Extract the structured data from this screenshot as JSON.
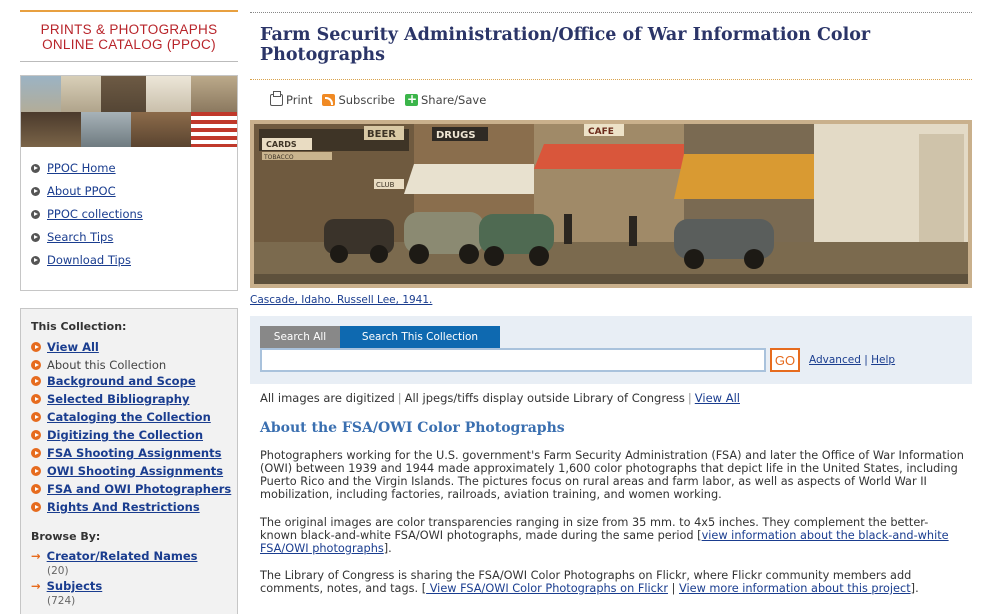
{
  "logo": {
    "line1": "PRINTS & PHOTOGRAPHS",
    "line2": "ONLINE CATALOG (PPOC)"
  },
  "nav": {
    "items": [
      {
        "label": "PPOC Home"
      },
      {
        "label": "About PPOC"
      },
      {
        "label": "PPOC collections"
      },
      {
        "label": "Search Tips"
      },
      {
        "label": "Download Tips"
      }
    ]
  },
  "collection": {
    "heading": "This Collection:",
    "items": [
      {
        "label": "View All",
        "link": true
      },
      {
        "label": "About this Collection",
        "link": false
      },
      {
        "label": "Background and Scope",
        "link": true
      },
      {
        "label": "Selected Bibliography",
        "link": true
      },
      {
        "label": "Cataloging the Collection",
        "link": true
      },
      {
        "label": "Digitizing the Collection",
        "link": true
      },
      {
        "label": "FSA Shooting Assignments",
        "link": true
      },
      {
        "label": "OWI Shooting Assignments",
        "link": true
      },
      {
        "label": "FSA and OWI Photographers",
        "link": true
      },
      {
        "label": "Rights And Restrictions",
        "link": true
      }
    ],
    "browse_heading": "Browse By:",
    "browse": [
      {
        "label": "Creator/Related Names",
        "count": "(20)"
      },
      {
        "label": "Subjects",
        "count": "(724)"
      }
    ]
  },
  "page_title": "Farm Security Administration/Office of War Information Color Photographs",
  "tools": {
    "print": "Print",
    "subscribe": "Subscribe",
    "share": "Share/Save"
  },
  "hero": {
    "caption": "Cascade, Idaho. Russell Lee, 1941.",
    "signs": {
      "beer": "BEER",
      "drugs": "DRUGS",
      "cafe": "CAFE",
      "cards": "CARDS",
      "club": "CLUB",
      "tobacco": "TOBACCO"
    }
  },
  "search": {
    "tab_all": "Search All",
    "tab_this": "Search This Collection",
    "input_value": "",
    "go": "GO",
    "advanced": "Advanced",
    "help": "Help"
  },
  "digitized": {
    "text1": "All images are digitized",
    "text2": "All jpegs/tiffs display outside Library of Congress",
    "view_all": "View All"
  },
  "about": {
    "heading": "About the FSA/OWI Color Photographs",
    "p1": "Photographers working for the U.S. government's Farm Security Administration (FSA) and later the Office of War Information (OWI) between 1939 and 1944 made approximately 1,600 color photographs that depict life in the United States, including Puerto Rico and the Virgin Islands. The pictures focus on rural areas and farm labor, as well as aspects of World War II mobilization, including factories, railroads, aviation training, and women working.",
    "p2_text": "The original images are color transparencies ranging in size from 35 mm. to 4x5 inches. They complement the better-known black-and-white FSA/OWI photographs, made during the same period [",
    "p2_link": "view information about the black-and-white FSA/OWI photographs",
    "p2_end": "].",
    "p3_text": "The Library of Congress is sharing the FSA/OWI Color Photographs on Flickr, where Flickr community members add comments, notes, and tags. [",
    "p3_link1": " View FSA/OWI Color Photographs on Flickr",
    "p3_sep": " | ",
    "p3_link2": "View more information about this project",
    "p3_end": "]."
  }
}
